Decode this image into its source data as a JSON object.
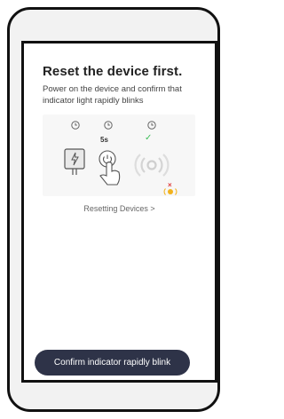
{
  "page": {
    "title": "Reset the device first.",
    "description": "Power on the device and confirm that indicator light rapidly blinks",
    "step2_duration": "5s",
    "resetting_link": "Resetting Devices >",
    "confirm_button": "Confirm indicator rapidly blink"
  },
  "icons": {
    "step_clock": "clock-icon",
    "power_plug": "power-plug-icon",
    "hand_press": "hand-press-button-icon",
    "blinking_light": "blinking-light-icon",
    "status_check": "check-icon",
    "status_x": "x-icon",
    "slow_light": "indicator-light-icon"
  },
  "colors": {
    "button_bg": "#2e3348",
    "check_green": "#3fbf5a",
    "error_red": "#e03a3a",
    "light_yellow": "#f2b21c"
  }
}
